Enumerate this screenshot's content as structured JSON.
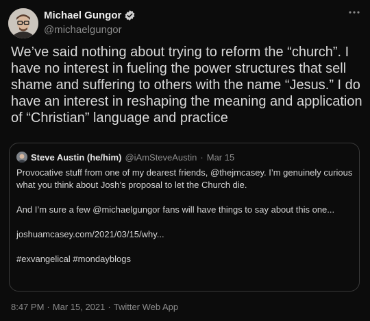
{
  "author": {
    "display_name": "Michael Gungor",
    "handle": "@michaelgungor",
    "verified": true
  },
  "tweet": {
    "text": "We’ve said nothing about trying to reform the “church”. I have no interest in fueling the power structures that sell shame and suffering to others with the name “Jesus.”  I do have an interest in reshaping the meaning and application of “Christian” language and practice"
  },
  "quoted_tweet": {
    "display_name": "Steve Austin (he/him)",
    "handle": "@iAmSteveAustin",
    "separator": "·",
    "date": "Mar 15",
    "paragraphs": [
      "Provocative stuff from one of my dearest friends, @thejmcasey. I’m genuinely curious what you think about Josh’s proposal to let the Church die.",
      "And I’m sure a few @michaelgungor fans will have things to say about this one...",
      "joshuamcasey.com/2021/03/15/why...",
      "#exvangelical #mondayblogs"
    ]
  },
  "footer": {
    "time": "8:47 PM",
    "separator1": "·",
    "date": "Mar 15, 2021",
    "separator2": "·",
    "source": "Twitter Web App"
  },
  "icons": {
    "more": "more-horizontal-icon",
    "verified": "verified-badge-icon"
  },
  "colors": {
    "background": "#0c0c0c",
    "text": "#d9d9d9",
    "secondary_text": "#8b8b8b",
    "card_border": "#3a3a3a"
  }
}
